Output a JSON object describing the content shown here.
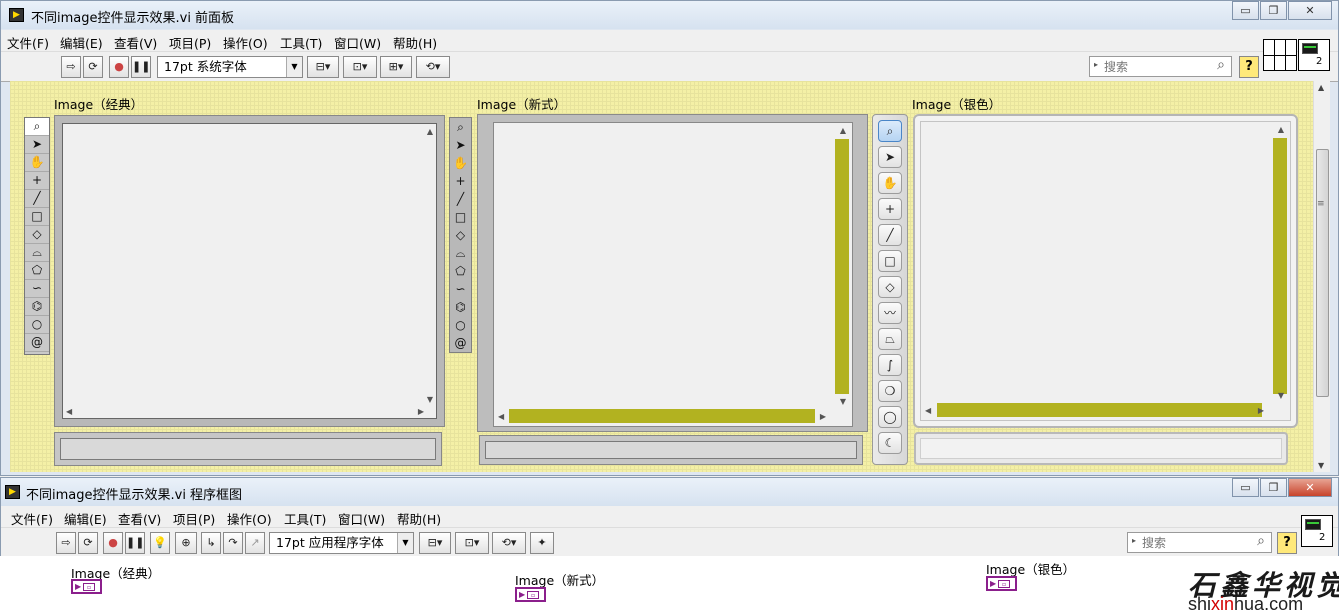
{
  "front_panel_window": {
    "title": "不同image控件显示效果.vi 前面板",
    "menu": [
      "文件(F)",
      "编辑(E)",
      "查看(V)",
      "项目(P)",
      "操作(O)",
      "工具(T)",
      "窗口(W)",
      "帮助(H)"
    ],
    "font_selector": "17pt 系统字体",
    "search_placeholder": "搜索",
    "help_label": "?",
    "controls": [
      {
        "label": "Image（经典）",
        "style": "classic"
      },
      {
        "label": "Image（新式）",
        "style": "modern"
      },
      {
        "label": "Image（银色）",
        "style": "silver"
      }
    ],
    "connector_pane_number": "2"
  },
  "block_diagram_window": {
    "title": "不同image控件显示效果.vi 程序框图",
    "menu": [
      "文件(F)",
      "编辑(E)",
      "查看(V)",
      "项目(P)",
      "操作(O)",
      "工具(T)",
      "窗口(W)",
      "帮助(H)"
    ],
    "font_selector": "17pt 应用程序字体",
    "search_placeholder": "搜索",
    "help_label": "?",
    "terminals": [
      {
        "label": "Image（经典）"
      },
      {
        "label": "Image（新式）"
      },
      {
        "label": "Image（银色）"
      }
    ],
    "icon_number": "2"
  },
  "watermark": {
    "chinese": "石鑫华视觉",
    "url": "shixinhua.com"
  },
  "colors": {
    "panel_background": "#f4f0a6",
    "scrollbar_accent": "#b2b220",
    "terminal_accent": "#8b1f8c",
    "watermark_red": "#d20000"
  },
  "icons": {
    "classic_tools": [
      "zoom-icon",
      "pointer-icon",
      "pan-hand-icon",
      "crosshair-icon",
      "line-icon",
      "rectangle-icon",
      "rotated-rect-icon",
      "annulus-icon",
      "polygon-icon",
      "freehand-icon",
      "broken-line-icon",
      "oval-icon",
      "spiral-icon"
    ],
    "silver_tools": [
      "zoom-icon",
      "pointer-icon",
      "pan-hand-icon",
      "crosshair-icon",
      "line-icon",
      "rectangle-icon",
      "rotated-rect-icon",
      "polyline-icon",
      "polygon-icon",
      "freehand-line-icon",
      "freehand-region-icon",
      "oval-icon",
      "annulus-icon"
    ]
  }
}
